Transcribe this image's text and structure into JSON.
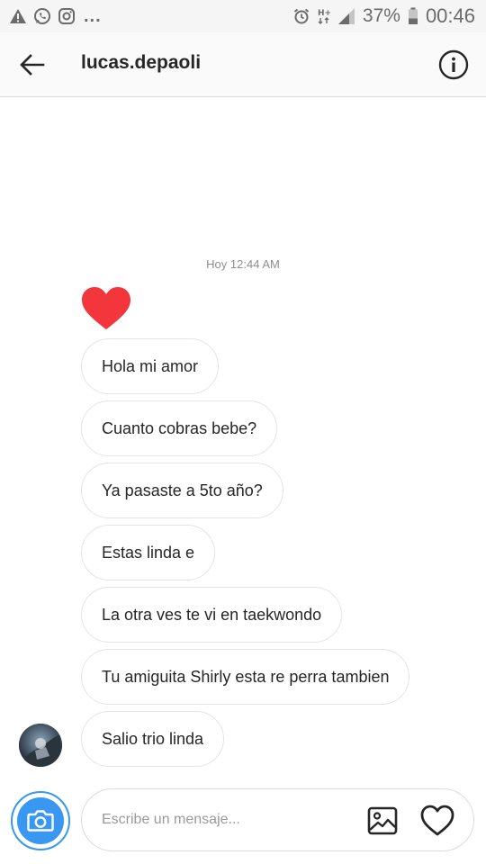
{
  "status_bar": {
    "battery": "37%",
    "time": "00:46",
    "more": "..."
  },
  "header": {
    "title": "lucas.depaoli"
  },
  "conversation": {
    "timestamp": "Hoy 12:44 AM",
    "messages": [
      {
        "type": "heart"
      },
      {
        "text": "Hola mi amor"
      },
      {
        "text": "Cuanto cobras bebe?"
      },
      {
        "text": "Ya pasaste a 5to año?"
      },
      {
        "text": "Estas linda e"
      },
      {
        "text": "La otra ves te vi en taekwondo"
      },
      {
        "text": "Tu amiguita Shirly esta re perra tambien"
      },
      {
        "text": "Salio trio linda"
      }
    ]
  },
  "composer": {
    "placeholder": "Escribe un mensaje...",
    "value": ""
  },
  "colors": {
    "heart": "#f2363c",
    "accent": "#3897f0",
    "bubble_border": "#e4e4e4"
  }
}
